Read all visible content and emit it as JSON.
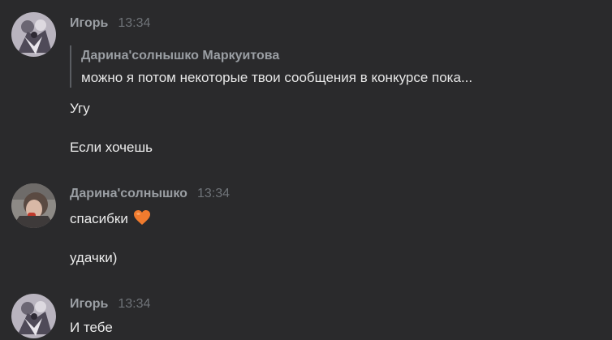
{
  "messages": [
    {
      "author": "Игорь",
      "time": "13:34",
      "reply": {
        "author": "Дарина'солнышко Маркуитова",
        "text": "можно я потом некоторые твои сообщения в конкурсе пока..."
      },
      "lines": [
        "Угу",
        "Если хочешь"
      ]
    },
    {
      "author": "Дарина'солнышко",
      "time": "13:34",
      "lines": [
        "спасибки",
        "удачки)"
      ],
      "emoji": "orange-heart-icon"
    },
    {
      "author": "Игорь",
      "time": "13:34",
      "lines": [
        "И тебе"
      ]
    }
  ],
  "colors": {
    "background": "#2a2a2c",
    "author": "#9a9ea3",
    "time": "#6f7378",
    "text": "#ececec",
    "heart": "#f07b2e"
  }
}
